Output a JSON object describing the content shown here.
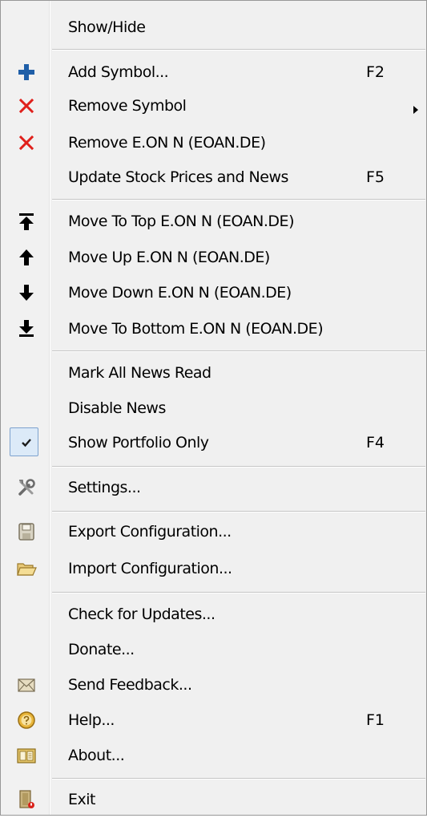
{
  "menu": {
    "items": [
      {
        "key": "show_hide",
        "label": "Show/Hide",
        "shortcut": "",
        "icon": ""
      },
      {
        "key": "add_symbol",
        "label": "Add Symbol...",
        "shortcut": "F2",
        "icon": "plus-icon"
      },
      {
        "key": "remove_symbol",
        "label": "Remove Symbol",
        "shortcut": "",
        "icon": "red-x-icon",
        "submenu": true
      },
      {
        "key": "remove_eon",
        "label": "Remove E.ON N (EOAN.DE)",
        "shortcut": "",
        "icon": "red-x-icon"
      },
      {
        "key": "update_prices",
        "label": "Update Stock Prices and News",
        "shortcut": "F5",
        "icon": ""
      },
      {
        "key": "move_top",
        "label": "Move To Top E.ON N (EOAN.DE)",
        "shortcut": "",
        "icon": "move-top-icon"
      },
      {
        "key": "move_up",
        "label": "Move Up E.ON N (EOAN.DE)",
        "shortcut": "",
        "icon": "arrow-up-icon"
      },
      {
        "key": "move_down",
        "label": "Move Down E.ON N (EOAN.DE)",
        "shortcut": "",
        "icon": "arrow-down-icon"
      },
      {
        "key": "move_bottom",
        "label": "Move To Bottom E.ON N (EOAN.DE)",
        "shortcut": "",
        "icon": "move-bottom-icon"
      },
      {
        "key": "mark_read",
        "label": "Mark All News Read",
        "shortcut": "",
        "icon": ""
      },
      {
        "key": "disable_news",
        "label": "Disable News",
        "shortcut": "",
        "icon": ""
      },
      {
        "key": "portfolio_only",
        "label": "Show Portfolio Only",
        "shortcut": "F4",
        "icon": "checkmark-icon",
        "checked": true
      },
      {
        "key": "settings",
        "label": "Settings...",
        "shortcut": "",
        "icon": "tools-icon"
      },
      {
        "key": "export_config",
        "label": "Export Configuration...",
        "shortcut": "",
        "icon": "save-disk-icon"
      },
      {
        "key": "import_config",
        "label": "Import Configuration...",
        "shortcut": "",
        "icon": "open-folder-icon"
      },
      {
        "key": "check_updates",
        "label": "Check for Updates...",
        "shortcut": "",
        "icon": ""
      },
      {
        "key": "donate",
        "label": "Donate...",
        "shortcut": "",
        "icon": ""
      },
      {
        "key": "send_feedback",
        "label": "Send Feedback...",
        "shortcut": "",
        "icon": "envelope-icon"
      },
      {
        "key": "help",
        "label": "Help...",
        "shortcut": "F1",
        "icon": "help-icon"
      },
      {
        "key": "about",
        "label": "About...",
        "shortcut": "",
        "icon": "about-book-icon"
      },
      {
        "key": "exit",
        "label": "Exit",
        "shortcut": "",
        "icon": "exit-door-icon"
      }
    ]
  },
  "colors": {
    "menu_background": "#f0f0f0",
    "separator": "#c5c5c5",
    "plus_icon": "#1f5fa8",
    "x_icon": "#e0201b",
    "check_highlight": "#dceaf8"
  }
}
